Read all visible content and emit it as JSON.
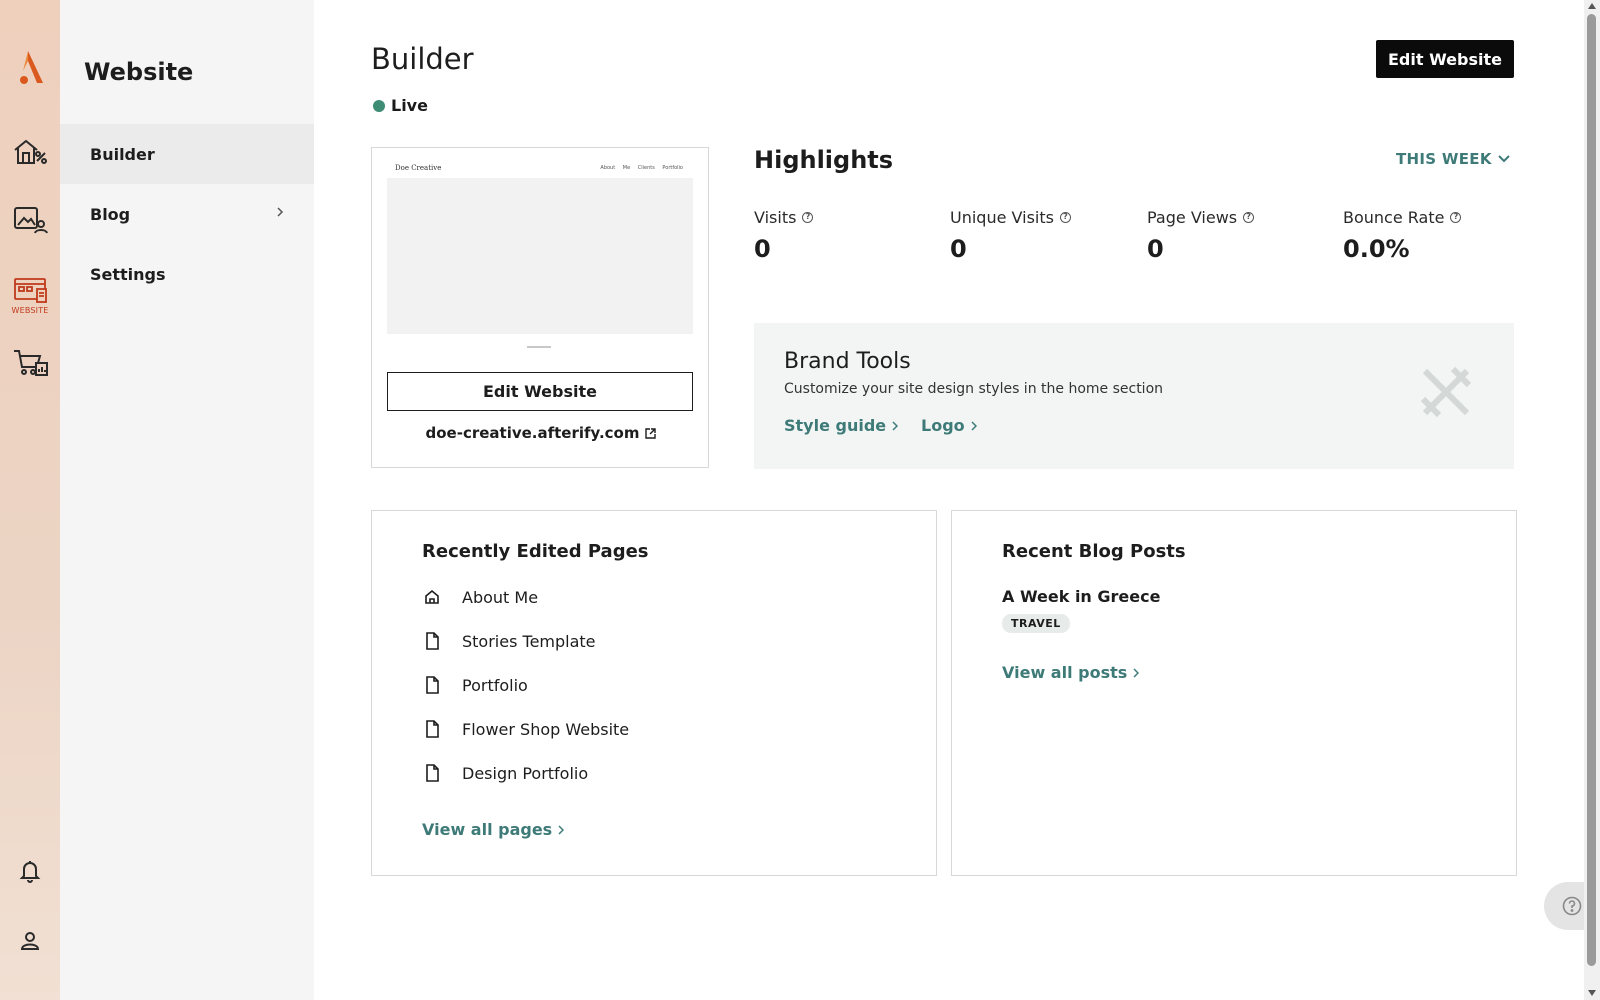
{
  "rail": {
    "items": [
      {
        "name": "logo-icon"
      },
      {
        "name": "home-sales-icon"
      },
      {
        "name": "gallery-clients-icon"
      },
      {
        "name": "website-icon",
        "caption": "WEBSITE"
      },
      {
        "name": "store-icon"
      },
      {
        "name": "bell-icon"
      },
      {
        "name": "user-icon"
      }
    ],
    "accent": "#c0391b"
  },
  "sidebar": {
    "title": "Website",
    "items": [
      {
        "label": "Builder",
        "active": true
      },
      {
        "label": "Blog",
        "has_submenu": true
      },
      {
        "label": "Settings"
      }
    ]
  },
  "header": {
    "title": "Builder",
    "status": "Live",
    "status_color": "#3f8c74",
    "edit_button": "Edit Website"
  },
  "preview": {
    "thumb_brand": "Doe Creative",
    "thumb_nav": "About Me Clients Portfolio",
    "edit_button": "Edit Website",
    "url": "doe-creative.afterify.com"
  },
  "highlights": {
    "title": "Highlights",
    "range": "THIS WEEK",
    "metrics": [
      {
        "label": "Visits",
        "value": "0"
      },
      {
        "label": "Unique Visits",
        "value": "0"
      },
      {
        "label": "Page Views",
        "value": "0"
      },
      {
        "label": "Bounce Rate",
        "value": "0.0%"
      }
    ]
  },
  "brand_tools": {
    "title": "Brand Tools",
    "description": "Customize your site design styles in the home section",
    "links": [
      "Style guide",
      "Logo"
    ]
  },
  "recent_pages": {
    "title": "Recently Edited Pages",
    "pages": [
      {
        "label": "About Me",
        "icon": "home-icon"
      },
      {
        "label": "Stories Template",
        "icon": "file-icon"
      },
      {
        "label": "Portfolio",
        "icon": "file-icon"
      },
      {
        "label": "Flower Shop Website",
        "icon": "file-icon"
      },
      {
        "label": "Design Portfolio",
        "icon": "file-icon"
      }
    ],
    "view_all": "View all pages"
  },
  "recent_posts": {
    "title": "Recent Blog Posts",
    "posts": [
      {
        "title": "A Week in Greece",
        "tag": "TRAVEL"
      }
    ],
    "view_all": "View all posts"
  },
  "colors": {
    "link": "#3d7a78",
    "dark_button": "#0b0b0b"
  }
}
